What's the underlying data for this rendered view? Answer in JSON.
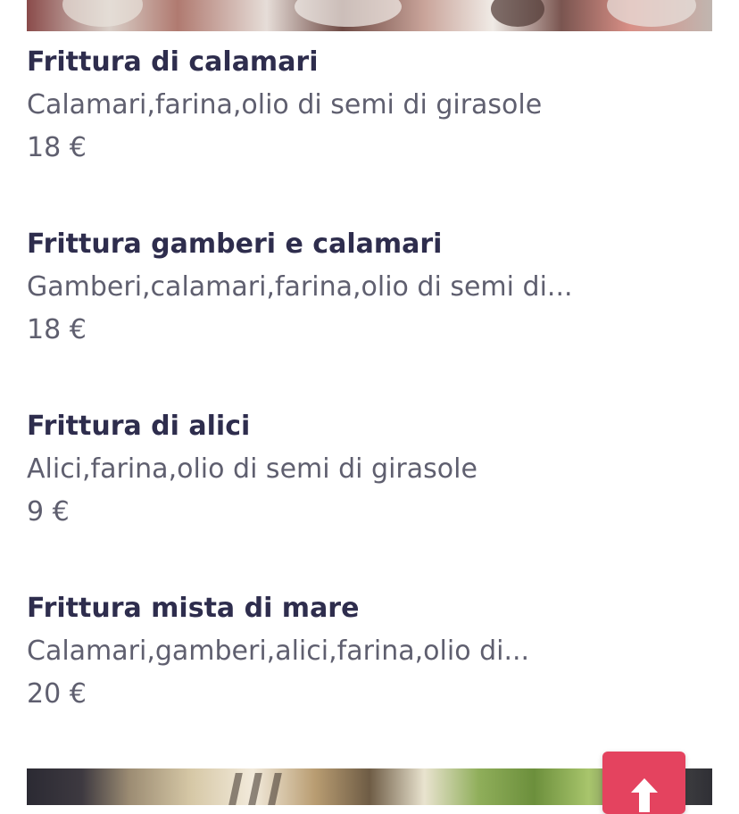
{
  "menu": {
    "items": [
      {
        "name": "Frittura di calamari",
        "description": "Calamari,farina,olio di semi di girasole",
        "price": "18 €"
      },
      {
        "name": "Frittura gamberi e calamari",
        "description": "Gamberi,calamari,farina,olio di semi di...",
        "price": "18 €"
      },
      {
        "name": "Frittura di alici",
        "description": "Alici,farina,olio di semi di girasole",
        "price": "9 €"
      },
      {
        "name": "Frittura mista di mare",
        "description": "Calamari,gamberi,alici,farina,olio di...",
        "price": "20 €"
      }
    ]
  },
  "back_to_top": {
    "icon": "arrow-up-icon",
    "color": "#e4435f"
  },
  "colors": {
    "title": "#2e2d4d",
    "text": "#5f5f6f"
  }
}
